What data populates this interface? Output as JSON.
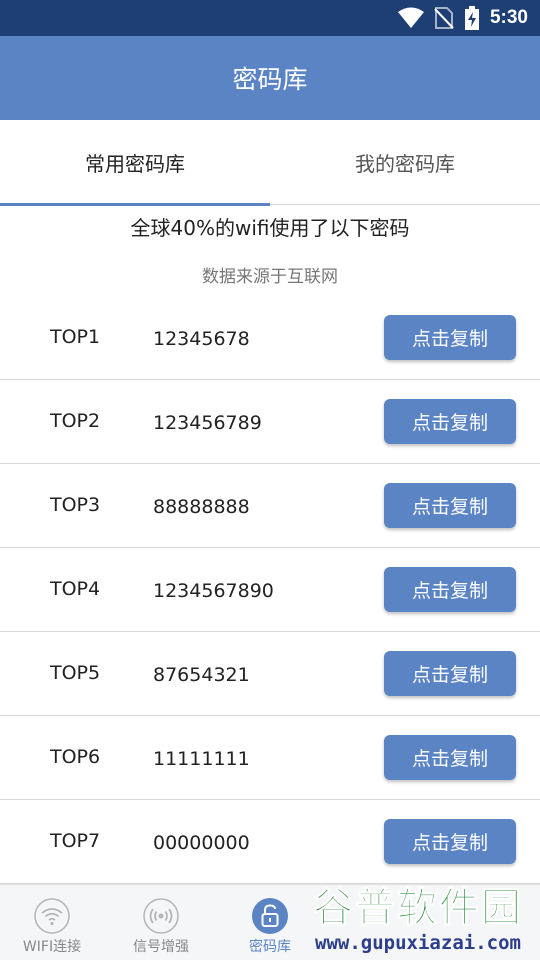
{
  "status_bar": {
    "time": "5:30",
    "icons": [
      "wifi-icon",
      "no-sim-icon",
      "battery-charging-icon"
    ]
  },
  "app_bar": {
    "title": "密码库"
  },
  "tabs": [
    {
      "label": "常用密码库",
      "active": true
    },
    {
      "label": "我的密码库",
      "active": false
    }
  ],
  "intro": {
    "headline": "全球40%的wifi使用了以下密码",
    "source": "数据来源于互联网"
  },
  "passwords": [
    {
      "rank": "TOP1",
      "value": "12345678",
      "button": "点击复制"
    },
    {
      "rank": "TOP2",
      "value": "123456789",
      "button": "点击复制"
    },
    {
      "rank": "TOP3",
      "value": "88888888",
      "button": "点击复制"
    },
    {
      "rank": "TOP4",
      "value": "1234567890",
      "button": "点击复制"
    },
    {
      "rank": "TOP5",
      "value": "87654321",
      "button": "点击复制"
    },
    {
      "rank": "TOP6",
      "value": "11111111",
      "button": "点击复制"
    },
    {
      "rank": "TOP7",
      "value": "00000000",
      "button": "点击复制"
    }
  ],
  "bottom_nav": [
    {
      "label": "WIFI连接",
      "icon": "wifi-icon",
      "active": false
    },
    {
      "label": "信号增强",
      "icon": "signal-icon",
      "active": false
    },
    {
      "label": "密码库",
      "icon": "lock-icon",
      "active": true
    }
  ],
  "watermark": {
    "logo": "谷普软件园",
    "url": "www.gupuxiazai.com"
  },
  "colors": {
    "primary": "#5a84c3",
    "status_bar": "#1e3f73",
    "divider": "#d8d8d8"
  }
}
